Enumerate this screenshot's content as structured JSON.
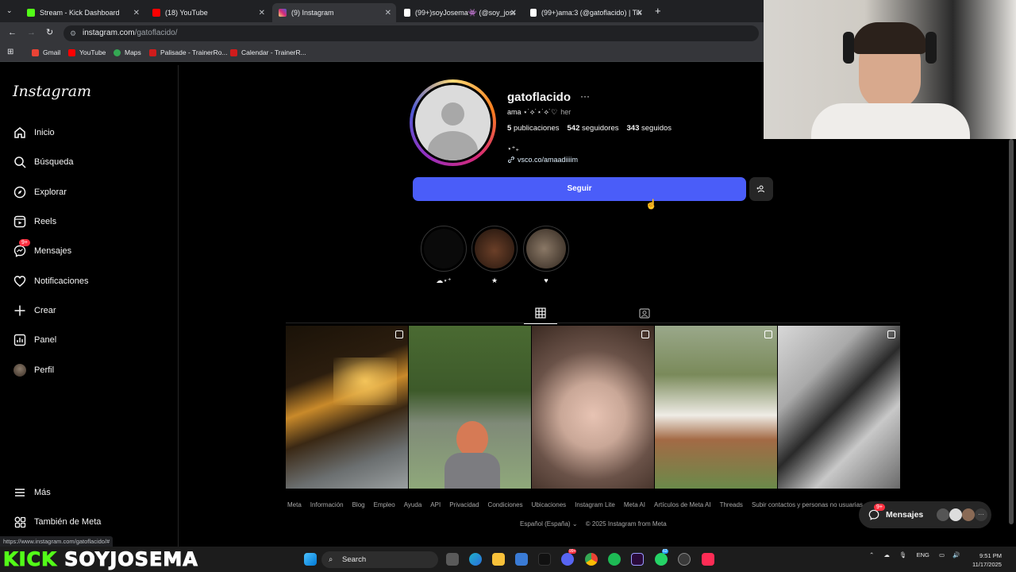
{
  "browser": {
    "tabs": [
      {
        "label": "Stream - Kick Dashboard",
        "favicon_color": "#53fc18"
      },
      {
        "label": "(18) YouTube",
        "favicon_color": "#ff0000"
      },
      {
        "label": "(9) Instagram",
        "favicon_color": "#d62976",
        "active": true
      },
      {
        "label": "(99+)soyJosema👾 (@soy_jose",
        "favicon_color": "#ffffff"
      },
      {
        "label": "(99+)ama:3 (@gatoflacido) | Tik",
        "favicon_color": "#ffffff"
      }
    ],
    "new_tab": "+",
    "url_host": "instagram.com",
    "url_path": "/gatoflacido/",
    "bookmarks": [
      "Gmail",
      "YouTube",
      "Maps",
      "Palisade - TrainerRo...",
      "Calendar - TrainerR..."
    ],
    "status_url": "https://www.instagram.com/gatoflacido/#"
  },
  "sidebar": {
    "logo": "Instagram",
    "items": [
      {
        "label": "Inicio",
        "icon": "home-icon"
      },
      {
        "label": "Búsqueda",
        "icon": "search-icon"
      },
      {
        "label": "Explorar",
        "icon": "compass-icon"
      },
      {
        "label": "Reels",
        "icon": "reels-icon"
      },
      {
        "label": "Mensajes",
        "icon": "messenger-icon",
        "badge": "9+"
      },
      {
        "label": "Notificaciones",
        "icon": "heart-icon"
      },
      {
        "label": "Crear",
        "icon": "plus-icon"
      },
      {
        "label": "Panel",
        "icon": "chart-icon"
      },
      {
        "label": "Perfil",
        "icon": "avatar-icon"
      }
    ],
    "bottom": [
      {
        "label": "Más",
        "icon": "menu-icon"
      },
      {
        "label": "También de Meta",
        "icon": "meta-icon"
      }
    ]
  },
  "profile": {
    "username": "gatoflacido",
    "more": "···",
    "fullname": "ama ⋆˙⟡˙⋆˙⟡˙♡",
    "pronoun": "her",
    "posts_count": "5",
    "posts_label": "publicaciones",
    "followers_count": "542",
    "followers_label": "seguidores",
    "following_count": "343",
    "following_label": "seguidos",
    "bio": "⋆⁺₊",
    "link": "vsco.co/amaadiiiim",
    "follow_label": "Seguir",
    "highlights": [
      {
        "label": "☁︎⋆⁺",
        "color": "#0a0a0a"
      },
      {
        "label": "★",
        "color": "#3a2418"
      },
      {
        "label": "♥",
        "color": "#5a4a3e"
      }
    ]
  },
  "posts": [
    {
      "colors": [
        "#1a1208",
        "#c98a2a",
        "#6b6f70"
      ]
    },
    {
      "colors": [
        "#3d5a2a",
        "#8fa87a",
        "#d67a55"
      ]
    },
    {
      "colors": [
        "#6a5248",
        "#c9a797",
        "#3b2a22"
      ]
    },
    {
      "colors": [
        "#7a8a5a",
        "#efece6",
        "#9a6a4a"
      ]
    },
    {
      "colors": [
        "#2a2a2a",
        "#d8d8d8",
        "#6a6a6a"
      ]
    }
  ],
  "footer": {
    "links": [
      "Meta",
      "Información",
      "Blog",
      "Empleo",
      "Ayuda",
      "API",
      "Privacidad",
      "Condiciones",
      "Ubicaciones",
      "Instagram Lite",
      "Meta AI",
      "Artículos de Meta AI",
      "Threads",
      "Subir contactos y personas no usuarias"
    ],
    "language": "Español (España)",
    "copyright": "© 2025 Instagram from Meta"
  },
  "messages_pill": {
    "label": "Mensajes",
    "badge": "9+"
  },
  "stream_overlay": {
    "kick": "KICK",
    "name": "SOYJOSEMA"
  },
  "taskbar": {
    "search_placeholder": "Search",
    "lang": "ENG",
    "time": "9:51 PM",
    "date": "11/17/2025",
    "badge_a": "99+",
    "badge_b": "63"
  },
  "colors": {
    "accent": "#4a5df9",
    "badge": "#ff3040",
    "kick": "#53fc18"
  }
}
